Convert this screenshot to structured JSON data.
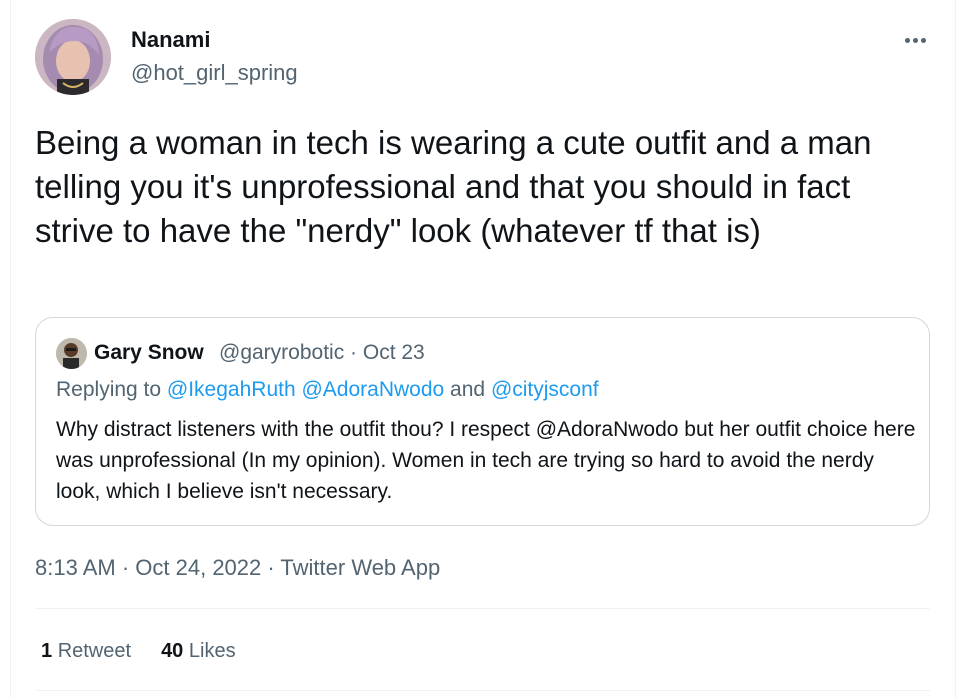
{
  "author": {
    "name": "Nanami",
    "handle": "@hot_girl_spring",
    "avatar_icon": "profile-photo"
  },
  "tweet": {
    "text": "Being a woman in tech is wearing a cute outfit and a man telling you it's unprofessional and that you should in fact strive to have the \"nerdy\" look (whatever tf that is)"
  },
  "quoted_tweet": {
    "name": "Gary Snow",
    "handle_date": "@garyrobotic · Oct 23",
    "replying_prefix": "Replying to ",
    "replying_user1": "@IkegahRuth",
    "replying_user2": "@AdoraNwodo",
    "replying_and": " and ",
    "replying_user3": "@cityjsconf",
    "text": "Why distract listeners with the outfit thou? I respect @AdoraNwodo  but her outfit choice here was unprofessional (In my opinion). Women in tech are trying so hard to avoid the nerdy look, which I believe isn't necessary."
  },
  "meta": {
    "time": "8:13 AM",
    "sep1": " · ",
    "date": "Oct 24, 2022",
    "sep2": " · ",
    "source": "Twitter Web App"
  },
  "stats": {
    "retweets_count": "1",
    "retweets_label": "Retweet",
    "likes_count": "40",
    "likes_label": "Likes"
  },
  "colors": {
    "link": "#1d9bf0",
    "secondary_text": "#536471",
    "primary_text": "#0f1419",
    "border": "#cfd9de"
  }
}
